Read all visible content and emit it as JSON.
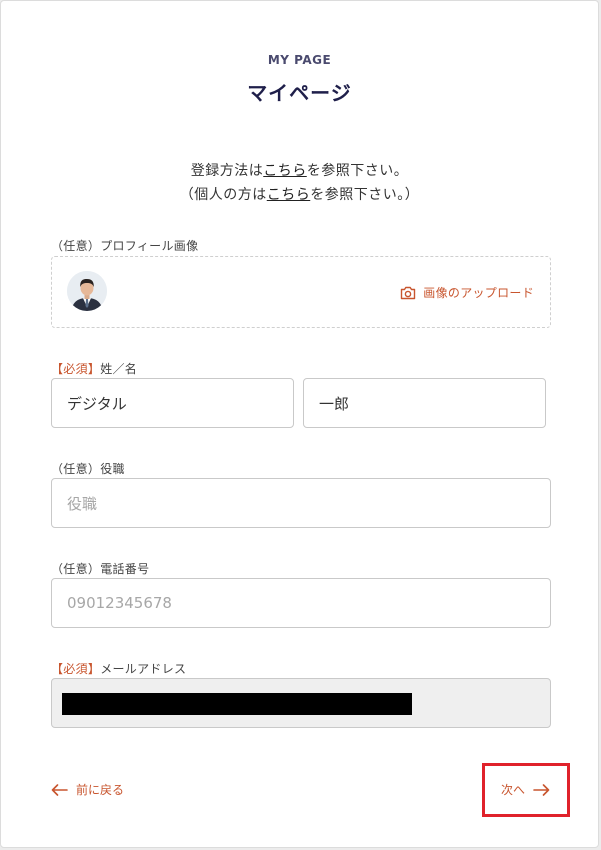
{
  "header": {
    "eyebrow": "MY PAGE",
    "title": "マイページ"
  },
  "intro": {
    "line1_prefix": "登録方法は",
    "line1_link": "こちら",
    "line1_suffix": "を参照下さい。",
    "line2_prefix": "（個人の方は",
    "line2_link": "こちら",
    "line2_suffix": "を参照下さい。）"
  },
  "profile_image": {
    "optional_tag": "（任意）",
    "label": "プロフィール画像",
    "upload_label": "画像のアップロード"
  },
  "name": {
    "required_tag": "【必須】",
    "label": "姓／名",
    "last_value": "デジタル",
    "first_value": "一郎"
  },
  "title_field": {
    "optional_tag": "（任意）",
    "label": "役職",
    "placeholder": "役職"
  },
  "phone": {
    "optional_tag": "（任意）",
    "label": "電話番号",
    "placeholder": "09012345678"
  },
  "email": {
    "required_tag": "【必須】",
    "label": "メールアドレス"
  },
  "nav": {
    "back_label": "前に戻る",
    "next_label": "次へ"
  },
  "colors": {
    "accent": "#c8552e",
    "heading": "#1f1f4a",
    "highlight": "#e0222b"
  }
}
